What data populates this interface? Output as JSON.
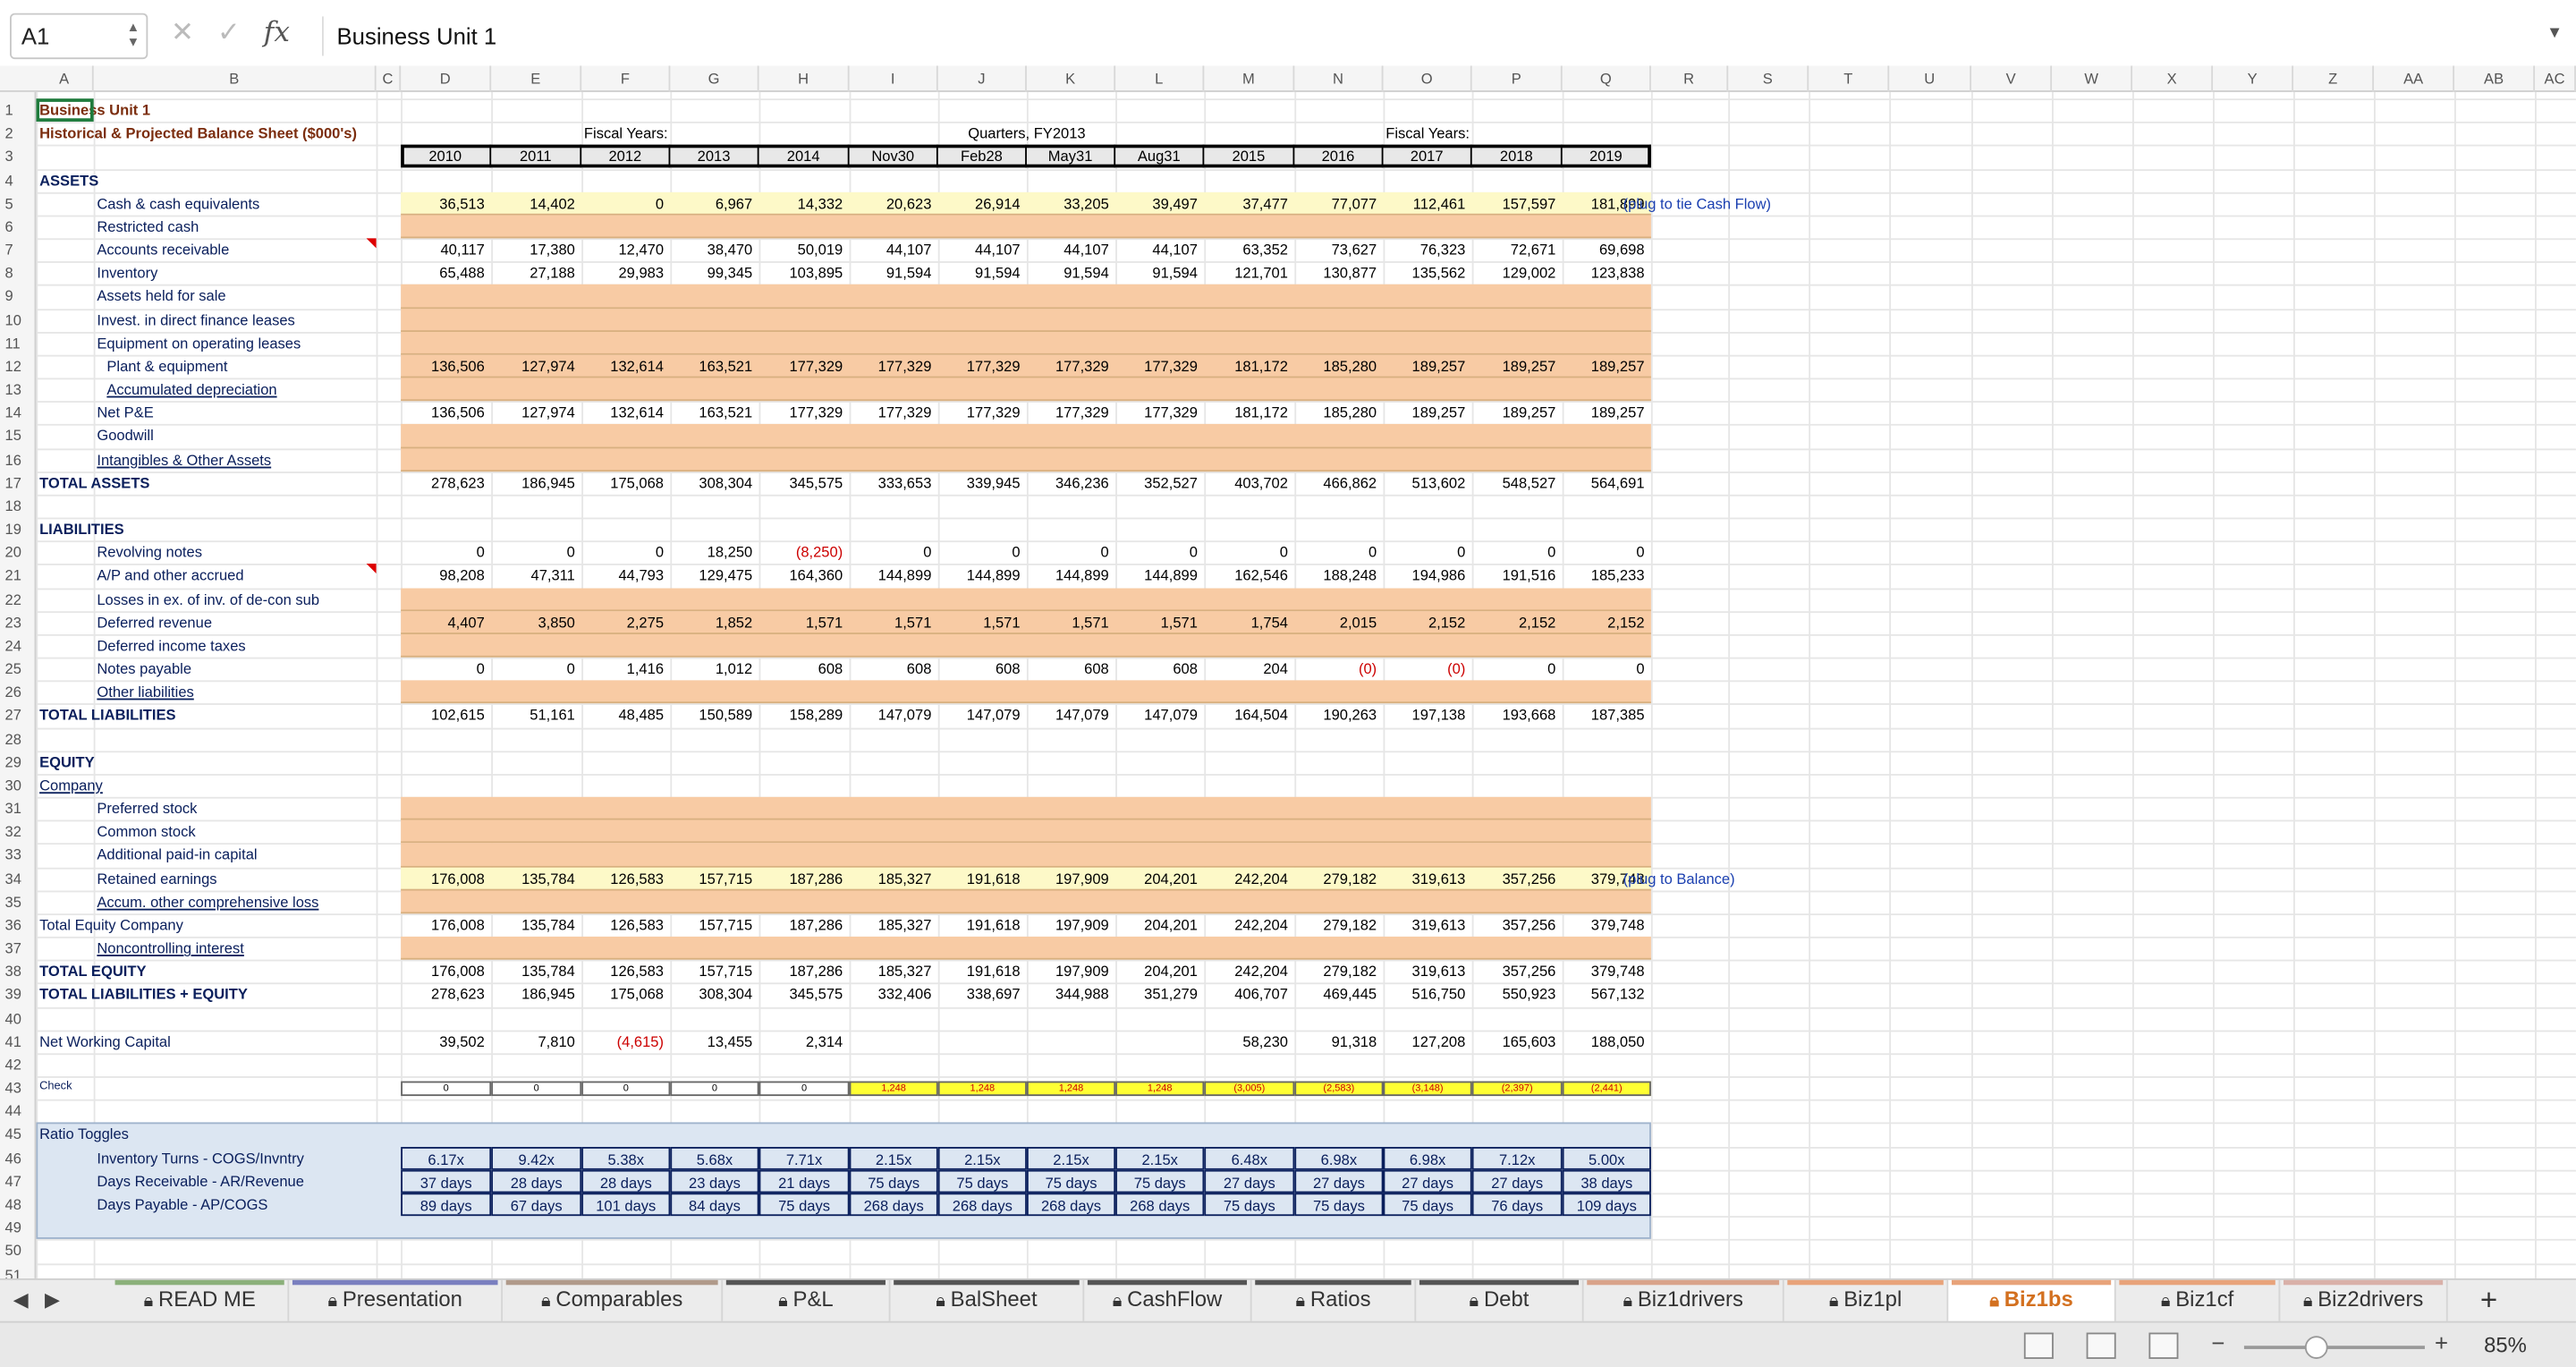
{
  "formula_bar": {
    "cell_ref": "A1",
    "formula": "Business Unit 1"
  },
  "columns": [
    "A",
    "B",
    "C",
    "D",
    "E",
    "F",
    "G",
    "H",
    "I",
    "J",
    "K",
    "L",
    "M",
    "N",
    "O",
    "P",
    "Q",
    "R",
    "S",
    "T",
    "U",
    "V",
    "W",
    "X",
    "Y",
    "Z",
    "AA",
    "AB",
    "AC",
    "A"
  ],
  "header": {
    "title": "Business Unit 1",
    "subtitle": "Historical & Projected Balance Sheet ($000's)",
    "fiscal_years_label": "Fiscal Years:",
    "quarters_label": "Quarters, FY2013",
    "fiscal_years_label2": "Fiscal Years:"
  },
  "years": [
    "2010",
    "2011",
    "2012",
    "2013",
    "2014",
    "Nov30",
    "Feb28",
    "May31",
    "Aug31",
    "2015",
    "2016",
    "2017",
    "2018",
    "2019"
  ],
  "rows": [
    {
      "r": 4,
      "label": "ASSETS",
      "style": "section"
    },
    {
      "r": 5,
      "label": "Cash & cash equivalents",
      "indent": 1,
      "vals": [
        "36,513",
        "14,402",
        "0",
        "6,967",
        "14,332",
        "20,623",
        "26,914",
        "33,205",
        "39,497",
        "37,477",
        "77,077",
        "112,461",
        "157,597",
        "181,899"
      ],
      "note": "(plug to tie Cash Flow)",
      "bg": "yellow"
    },
    {
      "r": 6,
      "label": "Restricted cash",
      "indent": 1,
      "vals": [],
      "bg": "orange"
    },
    {
      "r": 7,
      "label": "Accounts receivable",
      "indent": 1,
      "vals": [
        "40,117",
        "17,380",
        "12,470",
        "38,470",
        "50,019",
        "44,107",
        "44,107",
        "44,107",
        "44,107",
        "63,352",
        "73,627",
        "76,323",
        "72,671",
        "69,698"
      ]
    },
    {
      "r": 8,
      "label": "Inventory",
      "indent": 1,
      "vals": [
        "65,488",
        "27,188",
        "29,983",
        "99,345",
        "103,895",
        "91,594",
        "91,594",
        "91,594",
        "91,594",
        "121,701",
        "130,877",
        "135,562",
        "129,002",
        "123,838"
      ]
    },
    {
      "r": 9,
      "label": "Assets held for sale",
      "indent": 1,
      "vals": [],
      "bg": "orange"
    },
    {
      "r": 10,
      "label": "Invest. in direct finance leases",
      "indent": 1,
      "vals": [],
      "bg": "orange"
    },
    {
      "r": 11,
      "label": "Equipment on operating leases",
      "indent": 1,
      "vals": [],
      "bg": "orange"
    },
    {
      "r": 12,
      "label": "Plant & equipment",
      "indent": 2,
      "vals": [
        "136,506",
        "127,974",
        "132,614",
        "163,521",
        "177,329",
        "177,329",
        "177,329",
        "177,329",
        "177,329",
        "181,172",
        "185,280",
        "189,257",
        "189,257",
        "189,257"
      ],
      "bg": "orange"
    },
    {
      "r": 13,
      "label": "Accumulated depreciation",
      "indent": 2,
      "underline": true,
      "vals": [],
      "bg": "orange"
    },
    {
      "r": 14,
      "label": "Net P&E",
      "indent": 1,
      "vals": [
        "136,506",
        "127,974",
        "132,614",
        "163,521",
        "177,329",
        "177,329",
        "177,329",
        "177,329",
        "177,329",
        "181,172",
        "185,280",
        "189,257",
        "189,257",
        "189,257"
      ]
    },
    {
      "r": 15,
      "label": "Goodwill",
      "indent": 1,
      "vals": [],
      "bg": "orange"
    },
    {
      "r": 16,
      "label": "Intangibles & Other Assets",
      "indent": 1,
      "underline": true,
      "vals": [],
      "bg": "orange"
    },
    {
      "r": 17,
      "label": "TOTAL ASSETS",
      "style": "total",
      "vals": [
        "278,623",
        "186,945",
        "175,068",
        "308,304",
        "345,575",
        "333,653",
        "339,945",
        "346,236",
        "352,527",
        "403,702",
        "466,862",
        "513,602",
        "548,527",
        "564,691"
      ]
    },
    {
      "r": 19,
      "label": "LIABILITIES",
      "style": "section"
    },
    {
      "r": 20,
      "label": "Revolving notes",
      "indent": 1,
      "vals": [
        "0",
        "0",
        "0",
        "18,250",
        "(8,250)",
        "0",
        "0",
        "0",
        "0",
        "0",
        "0",
        "0",
        "0",
        "0"
      ]
    },
    {
      "r": 21,
      "label": "A/P and other accrued",
      "indent": 1,
      "vals": [
        "98,208",
        "47,311",
        "44,793",
        "129,475",
        "164,360",
        "144,899",
        "144,899",
        "144,899",
        "144,899",
        "162,546",
        "188,248",
        "194,986",
        "191,516",
        "185,233"
      ]
    },
    {
      "r": 22,
      "label": "Losses in ex. of inv. of de-con sub",
      "indent": 1,
      "vals": [],
      "bg": "orange"
    },
    {
      "r": 23,
      "label": "Deferred revenue",
      "indent": 1,
      "vals": [
        "4,407",
        "3,850",
        "2,275",
        "1,852",
        "1,571",
        "1,571",
        "1,571",
        "1,571",
        "1,571",
        "1,754",
        "2,015",
        "2,152",
        "2,152",
        "2,152"
      ],
      "bg": "orange"
    },
    {
      "r": 24,
      "label": "Deferred income taxes",
      "indent": 1,
      "vals": [],
      "bg": "orange"
    },
    {
      "r": 25,
      "label": "Notes payable",
      "indent": 1,
      "vals": [
        "0",
        "0",
        "1,416",
        "1,012",
        "608",
        "608",
        "608",
        "608",
        "608",
        "204",
        "(0)",
        "(0)",
        "0",
        "0"
      ]
    },
    {
      "r": 26,
      "label": "Other liabilities",
      "indent": 1,
      "underline": true,
      "vals": [],
      "bg": "orange"
    },
    {
      "r": 27,
      "label": "TOTAL LIABILITIES",
      "style": "total",
      "vals": [
        "102,615",
        "51,161",
        "48,485",
        "150,589",
        "158,289",
        "147,079",
        "147,079",
        "147,079",
        "147,079",
        "164,504",
        "190,263",
        "197,138",
        "193,668",
        "187,385"
      ]
    },
    {
      "r": 29,
      "label": "EQUITY",
      "style": "section"
    },
    {
      "r": 30,
      "label": "Company",
      "style": "company"
    },
    {
      "r": 31,
      "label": "Preferred stock",
      "indent": 1,
      "vals": [],
      "bg": "orange"
    },
    {
      "r": 32,
      "label": "Common stock",
      "indent": 1,
      "vals": [],
      "bg": "orange"
    },
    {
      "r": 33,
      "label": "Additional paid-in capital",
      "indent": 1,
      "vals": [],
      "bg": "orange"
    },
    {
      "r": 34,
      "label": "Retained earnings",
      "indent": 1,
      "vals": [
        "176,008",
        "135,784",
        "126,583",
        "157,715",
        "187,286",
        "185,327",
        "191,618",
        "197,909",
        "204,201",
        "242,204",
        "279,182",
        "319,613",
        "357,256",
        "379,748"
      ],
      "note": "(plug to Balance)",
      "bg": "yellow"
    },
    {
      "r": 35,
      "label": "Accum. other comprehensive loss",
      "indent": 1,
      "underline": true,
      "vals": [],
      "bg": "orange"
    },
    {
      "r": 36,
      "label": "Total Equity Company",
      "style": "plain",
      "vals": [
        "176,008",
        "135,784",
        "126,583",
        "157,715",
        "187,286",
        "185,327",
        "191,618",
        "197,909",
        "204,201",
        "242,204",
        "279,182",
        "319,613",
        "357,256",
        "379,748"
      ]
    },
    {
      "r": 37,
      "label": "Noncontrolling interest",
      "indent": 1,
      "underline": true,
      "vals": [],
      "bg": "orange"
    },
    {
      "r": 38,
      "label": "TOTAL EQUITY",
      "style": "total",
      "vals": [
        "176,008",
        "135,784",
        "126,583",
        "157,715",
        "187,286",
        "185,327",
        "191,618",
        "197,909",
        "204,201",
        "242,204",
        "279,182",
        "319,613",
        "357,256",
        "379,748"
      ]
    },
    {
      "r": 39,
      "label": "TOTAL LIABILITIES + EQUITY",
      "style": "total",
      "vals": [
        "278,623",
        "186,945",
        "175,068",
        "308,304",
        "345,575",
        "332,406",
        "338,697",
        "344,988",
        "351,279",
        "406,707",
        "469,445",
        "516,750",
        "550,923",
        "567,132"
      ]
    },
    {
      "r": 41,
      "label": "Net Working Capital",
      "style": "plain",
      "vals": [
        "39,502",
        "7,810",
        "(4,615)",
        "13,455",
        "2,314",
        "",
        "",
        "",
        "",
        "58,230",
        "91,318",
        "127,208",
        "165,603",
        "188,050"
      ]
    },
    {
      "r": 43,
      "label": "Check",
      "style": "check",
      "vals": [
        "0",
        "0",
        "0",
        "0",
        "0",
        "1,248",
        "1,248",
        "1,248",
        "1,248",
        "(3,005)",
        "(2,583)",
        "(3,148)",
        "(2,397)",
        "(2,441)"
      ]
    },
    {
      "r": 45,
      "label": "Ratio Toggles",
      "style": "ratio-head"
    },
    {
      "r": 46,
      "label": "Inventory Turns - COGS/Invntry",
      "indent": 1,
      "style": "ratio",
      "vals": [
        "6.17x",
        "9.42x",
        "5.38x",
        "5.68x",
        "7.71x",
        "2.15x",
        "2.15x",
        "2.15x",
        "2.15x",
        "6.48x",
        "6.98x",
        "6.98x",
        "7.12x",
        "5.00x"
      ]
    },
    {
      "r": 47,
      "label": "Days Receivable - AR/Revenue",
      "indent": 1,
      "style": "ratio",
      "vals": [
        "37 days",
        "28 days",
        "28 days",
        "23 days",
        "21 days",
        "75 days",
        "75 days",
        "75 days",
        "75 days",
        "27 days",
        "27 days",
        "27 days",
        "27 days",
        "38 days"
      ]
    },
    {
      "r": 48,
      "label": "Days Payable - AP/COGS",
      "indent": 1,
      "style": "ratio",
      "vals": [
        "89 days",
        "67 days",
        "101 days",
        "84 days",
        "75 days",
        "268 days",
        "268 days",
        "268 days",
        "268 days",
        "75 days",
        "75 days",
        "75 days",
        "76 days",
        "109 days"
      ]
    }
  ],
  "tabs": [
    {
      "label": "READ ME",
      "color": "#8bb07a"
    },
    {
      "label": "Presentation",
      "color": "#7a7fbf"
    },
    {
      "label": "Comparables",
      "color": "#b09a8a"
    },
    {
      "label": "P&L",
      "color": "#555555"
    },
    {
      "label": "BalSheet",
      "color": "#555555"
    },
    {
      "label": "CashFlow",
      "color": "#555555"
    },
    {
      "label": "Ratios",
      "color": "#555555"
    },
    {
      "label": "Debt",
      "color": "#555555"
    },
    {
      "label": "Biz1drivers",
      "color": "#d9a38a"
    },
    {
      "label": "Biz1pl",
      "color": "#e8a37a"
    },
    {
      "label": "Biz1bs",
      "color": "#e8a37a",
      "active": true
    },
    {
      "label": "Biz1cf",
      "color": "#e8a37a"
    },
    {
      "label": "Biz2drivers",
      "color": "#d9b0a8"
    }
  ],
  "status": {
    "zoom": "85%"
  }
}
